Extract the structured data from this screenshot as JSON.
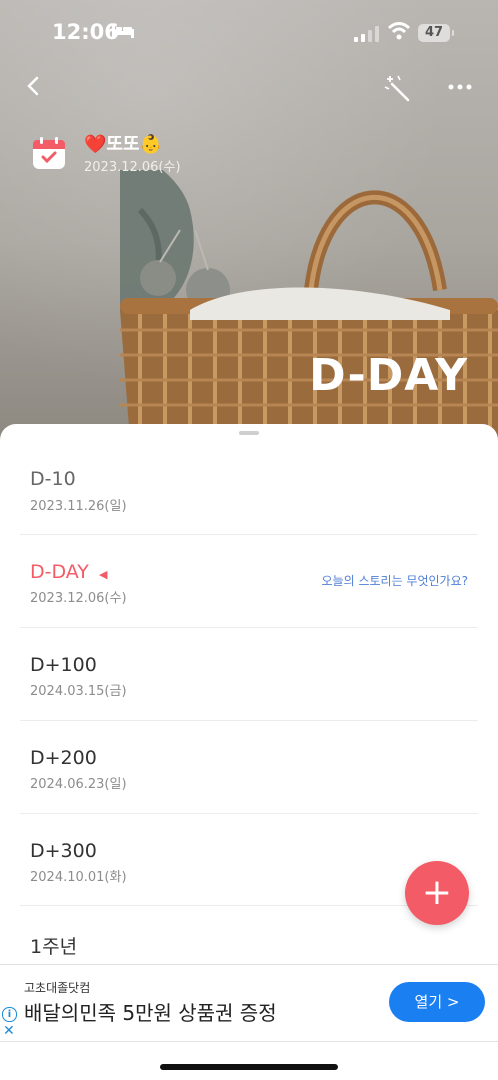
{
  "status_bar": {
    "time": "12:06",
    "battery": "47"
  },
  "header": {
    "name": "❤️또또👶",
    "date": "2023.12.06(수)",
    "banner_label": "D-DAY"
  },
  "list": [
    {
      "title": "D-10",
      "date": "2023.11.26(일)",
      "highlight": false
    },
    {
      "title": "D-DAY",
      "date": "2023.12.06(수)",
      "highlight": true,
      "story_link": "오늘의 스토리는 무엇인가요?"
    },
    {
      "title": "D+100",
      "date": "2024.03.15(금)",
      "highlight": false
    },
    {
      "title": "D+200",
      "date": "2024.06.23(일)",
      "highlight": false
    },
    {
      "title": "D+300",
      "date": "2024.10.01(화)",
      "highlight": false
    },
    {
      "title": "1주년",
      "date": "",
      "highlight": false
    }
  ],
  "fab": {
    "icon": "plus-icon",
    "label": "+"
  },
  "ad": {
    "brand": "고초대졸닷컴",
    "headline": "배달의민족 5만원 상품권 증정",
    "button": "열기 >"
  },
  "colors": {
    "accent": "#f35b66",
    "link": "#4f7fd6",
    "ad_button": "#1a7ff0"
  }
}
